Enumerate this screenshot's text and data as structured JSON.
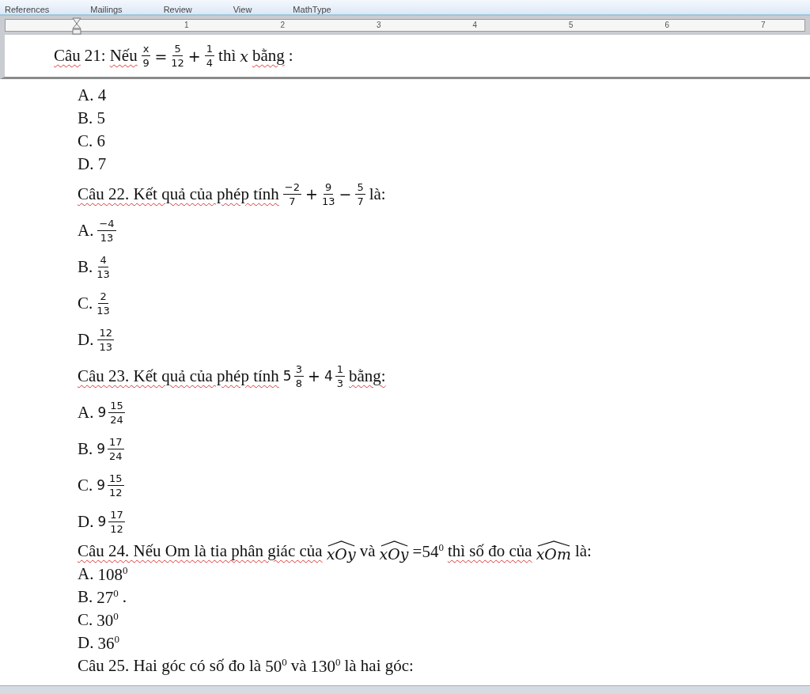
{
  "ribbon_tabs": [
    "References",
    "Mailings",
    "Review",
    "View",
    "MathType"
  ],
  "ruler": {
    "numbers": [
      "1",
      "2",
      "3",
      "4",
      "5",
      "6",
      "7"
    ]
  },
  "header_pane": {
    "lines": [
      {
        "parts": [
          {
            "kind": "text",
            "text": "Câu",
            "flagged": true
          },
          {
            "kind": "text",
            "text": " 21: ",
            "flagged": false
          },
          {
            "kind": "text",
            "text": "Nếu",
            "flagged": true
          },
          {
            "kind": "frac",
            "num": "x",
            "den": "9"
          },
          {
            "kind": "op",
            "text": "="
          },
          {
            "kind": "frac",
            "num": "5",
            "den": "12"
          },
          {
            "kind": "op",
            "text": "+"
          },
          {
            "kind": "frac",
            "num": "1",
            "den": "4"
          },
          {
            "kind": "text",
            "text": "thì ",
            "flagged": false
          },
          {
            "kind": "var",
            "text": "x"
          },
          {
            "kind": "text",
            "text": "bằng",
            "flagged": true
          },
          {
            "kind": "text",
            "text": ":",
            "flagged": false
          }
        ]
      }
    ]
  },
  "document": {
    "lines": [
      {
        "parts": [
          {
            "kind": "text",
            "text": "A. 4",
            "flagged": false
          }
        ]
      },
      {
        "parts": [
          {
            "kind": "text",
            "text": "B. 5",
            "flagged": false
          }
        ]
      },
      {
        "parts": [
          {
            "kind": "text",
            "text": "C. 6",
            "flagged": false
          }
        ]
      },
      {
        "parts": [
          {
            "kind": "text",
            "text": "D. 7",
            "flagged": false
          }
        ]
      },
      {
        "parts": [
          {
            "kind": "text",
            "text": "Câu 22. Kết quả của phép tính",
            "flagged": true
          },
          {
            "kind": "frac",
            "num": "−2",
            "den": "7"
          },
          {
            "kind": "op",
            "text": "+"
          },
          {
            "kind": "frac",
            "num": "9",
            "den": "13"
          },
          {
            "kind": "op",
            "text": "−"
          },
          {
            "kind": "frac",
            "num": "5",
            "den": "7"
          },
          {
            "kind": "text",
            "text": "là:",
            "flagged": false
          }
        ]
      },
      {
        "parts": [
          {
            "kind": "text",
            "text": "A.",
            "flagged": false
          },
          {
            "kind": "frac",
            "num": "−4",
            "den": "13"
          }
        ]
      },
      {
        "parts": [
          {
            "kind": "text",
            "text": "B.",
            "flagged": false
          },
          {
            "kind": "frac",
            "num": "4",
            "den": "13"
          }
        ]
      },
      {
        "parts": [
          {
            "kind": "text",
            "text": "C.",
            "flagged": false
          },
          {
            "kind": "frac",
            "num": "2",
            "den": "13"
          }
        ]
      },
      {
        "parts": [
          {
            "kind": "text",
            "text": "D.",
            "flagged": false
          },
          {
            "kind": "frac",
            "num": "12",
            "den": "13"
          }
        ]
      },
      {
        "parts": [
          {
            "kind": "text",
            "text": "Câu 23. Kết quả của phép tính",
            "flagged": true
          },
          {
            "kind": "mixed",
            "whole": "5",
            "num": "3",
            "den": "8"
          },
          {
            "kind": "op",
            "text": "+"
          },
          {
            "kind": "mixed",
            "whole": "4",
            "num": "1",
            "den": "3"
          },
          {
            "kind": "text",
            "text": "bằng:",
            "flagged": true
          }
        ]
      },
      {
        "parts": [
          {
            "kind": "text",
            "text": "A.",
            "flagged": false
          },
          {
            "kind": "mixed",
            "whole": "9",
            "num": "15",
            "den": "24"
          }
        ]
      },
      {
        "parts": [
          {
            "kind": "text",
            "text": "B.",
            "flagged": false
          },
          {
            "kind": "mixed",
            "whole": "9",
            "num": "17",
            "den": "24"
          }
        ]
      },
      {
        "parts": [
          {
            "kind": "text",
            "text": "C.",
            "flagged": false
          },
          {
            "kind": "mixed",
            "whole": "9",
            "num": "15",
            "den": "12"
          }
        ]
      },
      {
        "parts": [
          {
            "kind": "text",
            "text": "D.",
            "flagged": false
          },
          {
            "kind": "mixed",
            "whole": "9",
            "num": "17",
            "den": "12"
          }
        ]
      },
      {
        "parts": [
          {
            "kind": "text",
            "text": "Câu 24. Nếu Om là tia phân giác của",
            "flagged": true
          },
          {
            "kind": "angle",
            "text": "xOy"
          },
          {
            "kind": "text",
            "text": "và",
            "flagged": false
          },
          {
            "kind": "angle",
            "text": "xOy"
          },
          {
            "kind": "power",
            "base": "=54",
            "exp": "0"
          },
          {
            "kind": "text",
            "text": "thì số đo của",
            "flagged": true
          },
          {
            "kind": "angle",
            "text": "xOm"
          },
          {
            "kind": "text",
            "text": "là:",
            "flagged": false
          }
        ]
      },
      {
        "parts": [
          {
            "kind": "text",
            "text": "A.",
            "flagged": false
          },
          {
            "kind": "power",
            "base": "108",
            "exp": "0"
          }
        ]
      },
      {
        "parts": [
          {
            "kind": "text",
            "text": "B.",
            "flagged": false
          },
          {
            "kind": "power",
            "base": "27",
            "exp": "0"
          },
          {
            "kind": "text",
            "text": ".",
            "flagged": false
          }
        ]
      },
      {
        "parts": [
          {
            "kind": "text",
            "text": "C.",
            "flagged": false
          },
          {
            "kind": "power",
            "base": "30",
            "exp": "0"
          }
        ]
      },
      {
        "parts": [
          {
            "kind": "text",
            "text": "D.",
            "flagged": false
          },
          {
            "kind": "power",
            "base": "36",
            "exp": "0"
          }
        ]
      },
      {
        "parts": [
          {
            "kind": "text",
            "text": "Câu 25. Hai góc có số đo là",
            "flagged": false
          },
          {
            "kind": "power",
            "base": "50",
            "exp": "0"
          },
          {
            "kind": "text",
            "text": "và",
            "flagged": false
          },
          {
            "kind": "power",
            "base": "130",
            "exp": "0"
          },
          {
            "kind": "text",
            "text": "là hai góc:",
            "flagged": false
          }
        ]
      }
    ]
  }
}
